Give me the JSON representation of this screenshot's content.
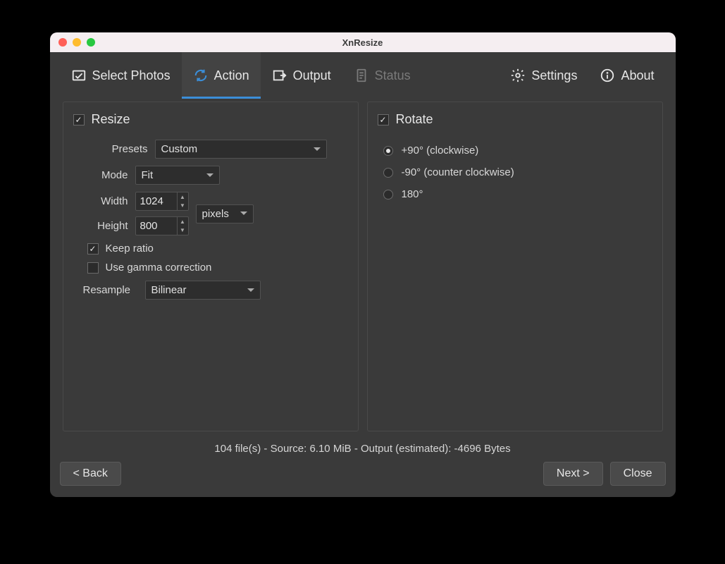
{
  "window": {
    "title": "XnResize"
  },
  "tabs": {
    "select_photos": "Select Photos",
    "action": "Action",
    "output": "Output",
    "status": "Status",
    "settings": "Settings",
    "about": "About",
    "active": "action"
  },
  "resize": {
    "enabled": true,
    "title": "Resize",
    "presets_label": "Presets",
    "presets_value": "Custom",
    "mode_label": "Mode",
    "mode_value": "Fit",
    "width_label": "Width",
    "width_value": "1024",
    "height_label": "Height",
    "height_value": "800",
    "unit_value": "pixels",
    "keep_ratio_checked": true,
    "keep_ratio_label": "Keep ratio",
    "gamma_checked": false,
    "gamma_label": "Use gamma correction",
    "resample_label": "Resample",
    "resample_value": "Bilinear"
  },
  "rotate": {
    "enabled": true,
    "title": "Rotate",
    "options": [
      {
        "label": "+90° (clockwise)",
        "checked": true
      },
      {
        "label": "-90° (counter clockwise)",
        "checked": false
      },
      {
        "label": "180°",
        "checked": false
      }
    ]
  },
  "status_text": "104 file(s) - Source: 6.10 MiB - Output (estimated): -4696 Bytes",
  "buttons": {
    "back": "< Back",
    "next": "Next >",
    "close": "Close"
  }
}
